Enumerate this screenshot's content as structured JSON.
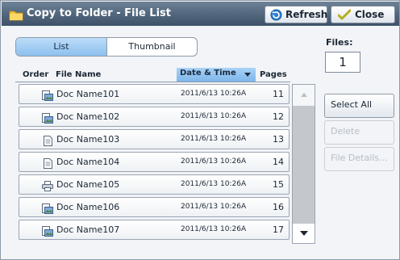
{
  "header": {
    "title": "Copy to Folder - File List",
    "refresh_label": "Refresh",
    "close_label": "Close"
  },
  "view_toggle": {
    "list_label": "List",
    "thumbnail_label": "Thumbnail",
    "selected": "List"
  },
  "table": {
    "columns": {
      "order": "Order",
      "file_name": "File Name",
      "date_time": "Date & Time",
      "pages": "Pages"
    },
    "sorted_by": "Date & Time",
    "rows": [
      {
        "name": "Doc Name101",
        "date": "2011/6/13 10:26A",
        "pages": "11",
        "icon": "scanned-doc-icon"
      },
      {
        "name": "Doc Name102",
        "date": "2011/6/13 10:26A",
        "pages": "12",
        "icon": "scanned-doc-icon"
      },
      {
        "name": "Doc Name103",
        "date": "2011/6/13 10:26A",
        "pages": "13",
        "icon": "document-icon"
      },
      {
        "name": "Doc Name104",
        "date": "2011/6/13 10:26A",
        "pages": "14",
        "icon": "document-icon"
      },
      {
        "name": "Doc Name105",
        "date": "2011/6/13 10:26A",
        "pages": "15",
        "icon": "printer-icon"
      },
      {
        "name": "Doc Name106",
        "date": "2011/6/13 10:26A",
        "pages": "16",
        "icon": "scanned-doc-icon"
      },
      {
        "name": "Doc Name107",
        "date": "2011/6/13 10:26A",
        "pages": "17",
        "icon": "scanned-doc-icon"
      }
    ]
  },
  "files": {
    "label": "Files:",
    "count": "1"
  },
  "actions": {
    "select_all": "Select All",
    "delete": "Delete",
    "file_details": "File Details..."
  },
  "colors": {
    "title_bar": "#556a80",
    "selected_tab": "#8cc0ee",
    "sort_column": "#7eb6ea"
  }
}
